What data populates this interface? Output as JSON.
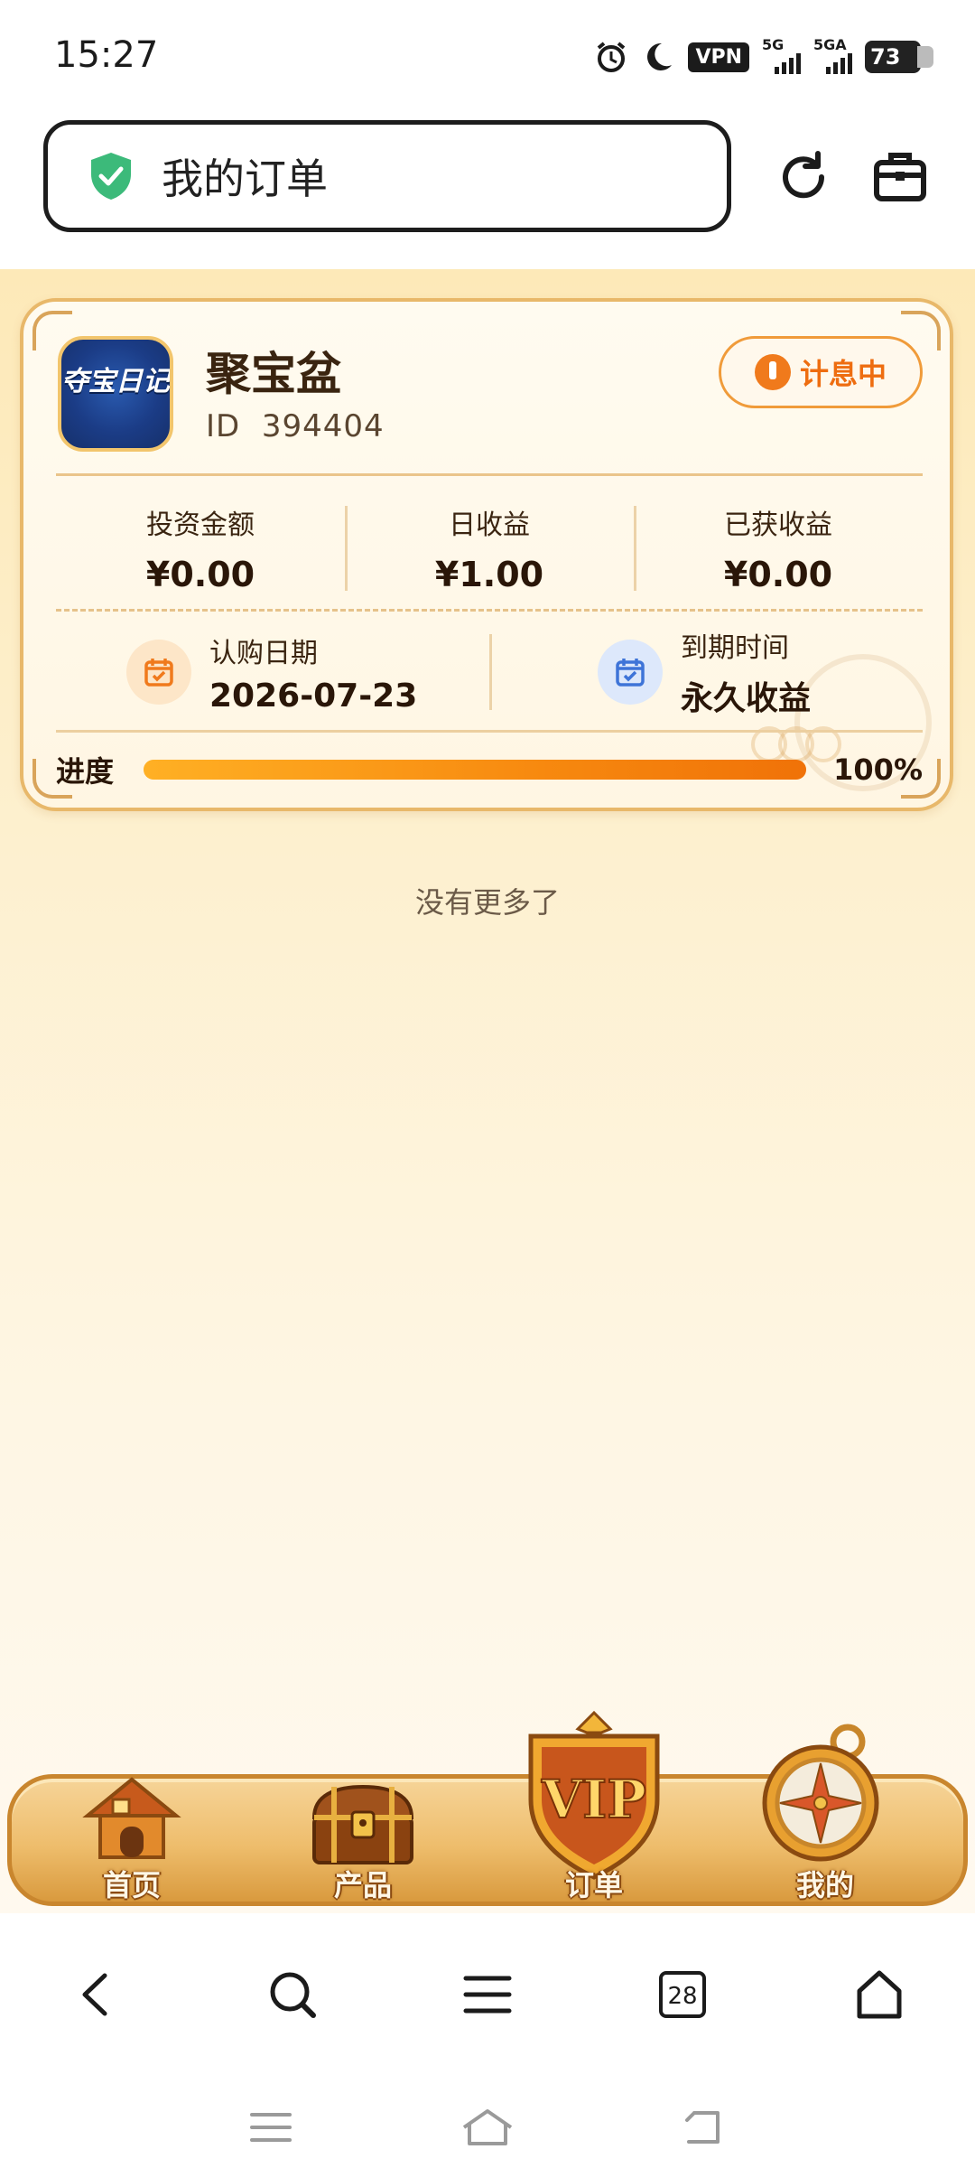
{
  "status_bar": {
    "time": "15:27",
    "vpn": "VPN",
    "sim1": "5G",
    "sim2": "5GA",
    "battery": "73"
  },
  "browser": {
    "page_title": "我的订单"
  },
  "order": {
    "product_name": "聚宝盆",
    "product_icon_text": "夺宝日记",
    "id_label": "ID",
    "id_value": "394404",
    "status": "计息中",
    "stats": [
      {
        "label": "投资金额",
        "value": "¥0.00"
      },
      {
        "label": "日收益",
        "value": "¥1.00"
      },
      {
        "label": "已获收益",
        "value": "¥0.00"
      }
    ],
    "purchase_date_label": "认购日期",
    "purchase_date": "2026-07-23",
    "expiry_label": "到期时间",
    "expiry_value": "永久收益",
    "progress_label": "进度",
    "progress_text": "100%",
    "progress": 1.0
  },
  "list_end_text": "没有更多了",
  "bottom_nav": [
    {
      "label": "首页",
      "icon": "house-icon"
    },
    {
      "label": "产品",
      "icon": "treasure-chest-icon"
    },
    {
      "label": "订单",
      "icon": "vip-shield-icon",
      "badge_text": "VIP"
    },
    {
      "label": "我的",
      "icon": "compass-icon"
    }
  ],
  "browser_toolbar": {
    "tabs_count": "28"
  },
  "colors": {
    "accent": "#f07a1c",
    "progress_start": "#ffb024",
    "progress_end": "#f07208",
    "card_border": "#e8b86a"
  }
}
